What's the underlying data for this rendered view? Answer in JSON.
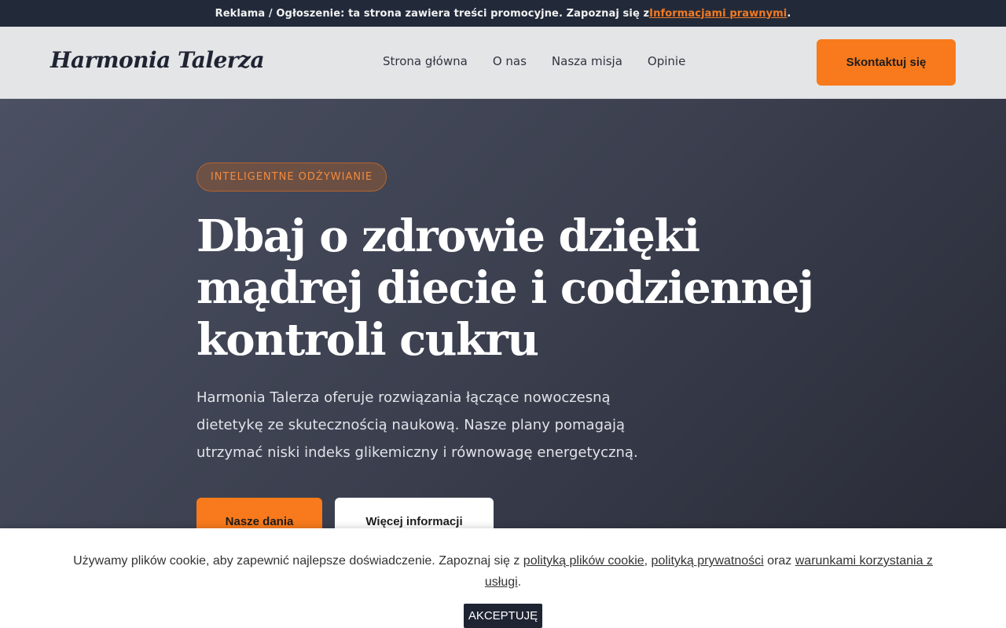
{
  "ad_bar": {
    "text": "Reklama / Ogłoszenie: ta strona zawiera treści promocyjne. Zapoznaj się z",
    "link": "Informacjami prawnymi",
    "suffix": "."
  },
  "header": {
    "logo": "Harmonia Talerza",
    "nav": [
      "Strona główna",
      "O nas",
      "Nasza misja",
      "Opinie"
    ],
    "contact_label": "Skontaktuj się"
  },
  "hero": {
    "badge": "INTELIGENTNE ODŻYWIANIE",
    "headline": "Dbaj o zdrowie dzięki mądrej diecie i codziennej kontroli cukru",
    "lead": "Harmonia Talerza oferuje rozwiązania łączące nowoczesną dietetykę ze skutecznością naukową. Nasze plany pomagają utrzymać niski indeks glikemiczny i równowagę energetyczną.",
    "primary_cta": "Nasze dania",
    "secondary_cta": "Więcej informacji"
  },
  "cookie": {
    "text_before": "Używamy plików cookie, aby zapewnić najlepsze doświadczenie. Zapoznaj się z ",
    "link_cookie": "polityką plików cookie",
    "sep1": ", ",
    "link_privacy": "polityką prywatności",
    "sep2": " oraz ",
    "link_terms": "warunkami korzystania z usługi",
    "text_after": ".",
    "accept_label": "AKCEPTUJĘ"
  },
  "colors": {
    "accent": "#f87a1c",
    "dark": "#1f2433",
    "ad_bar_bg": "#222a3a",
    "header_bg": "#e4e5e7"
  }
}
